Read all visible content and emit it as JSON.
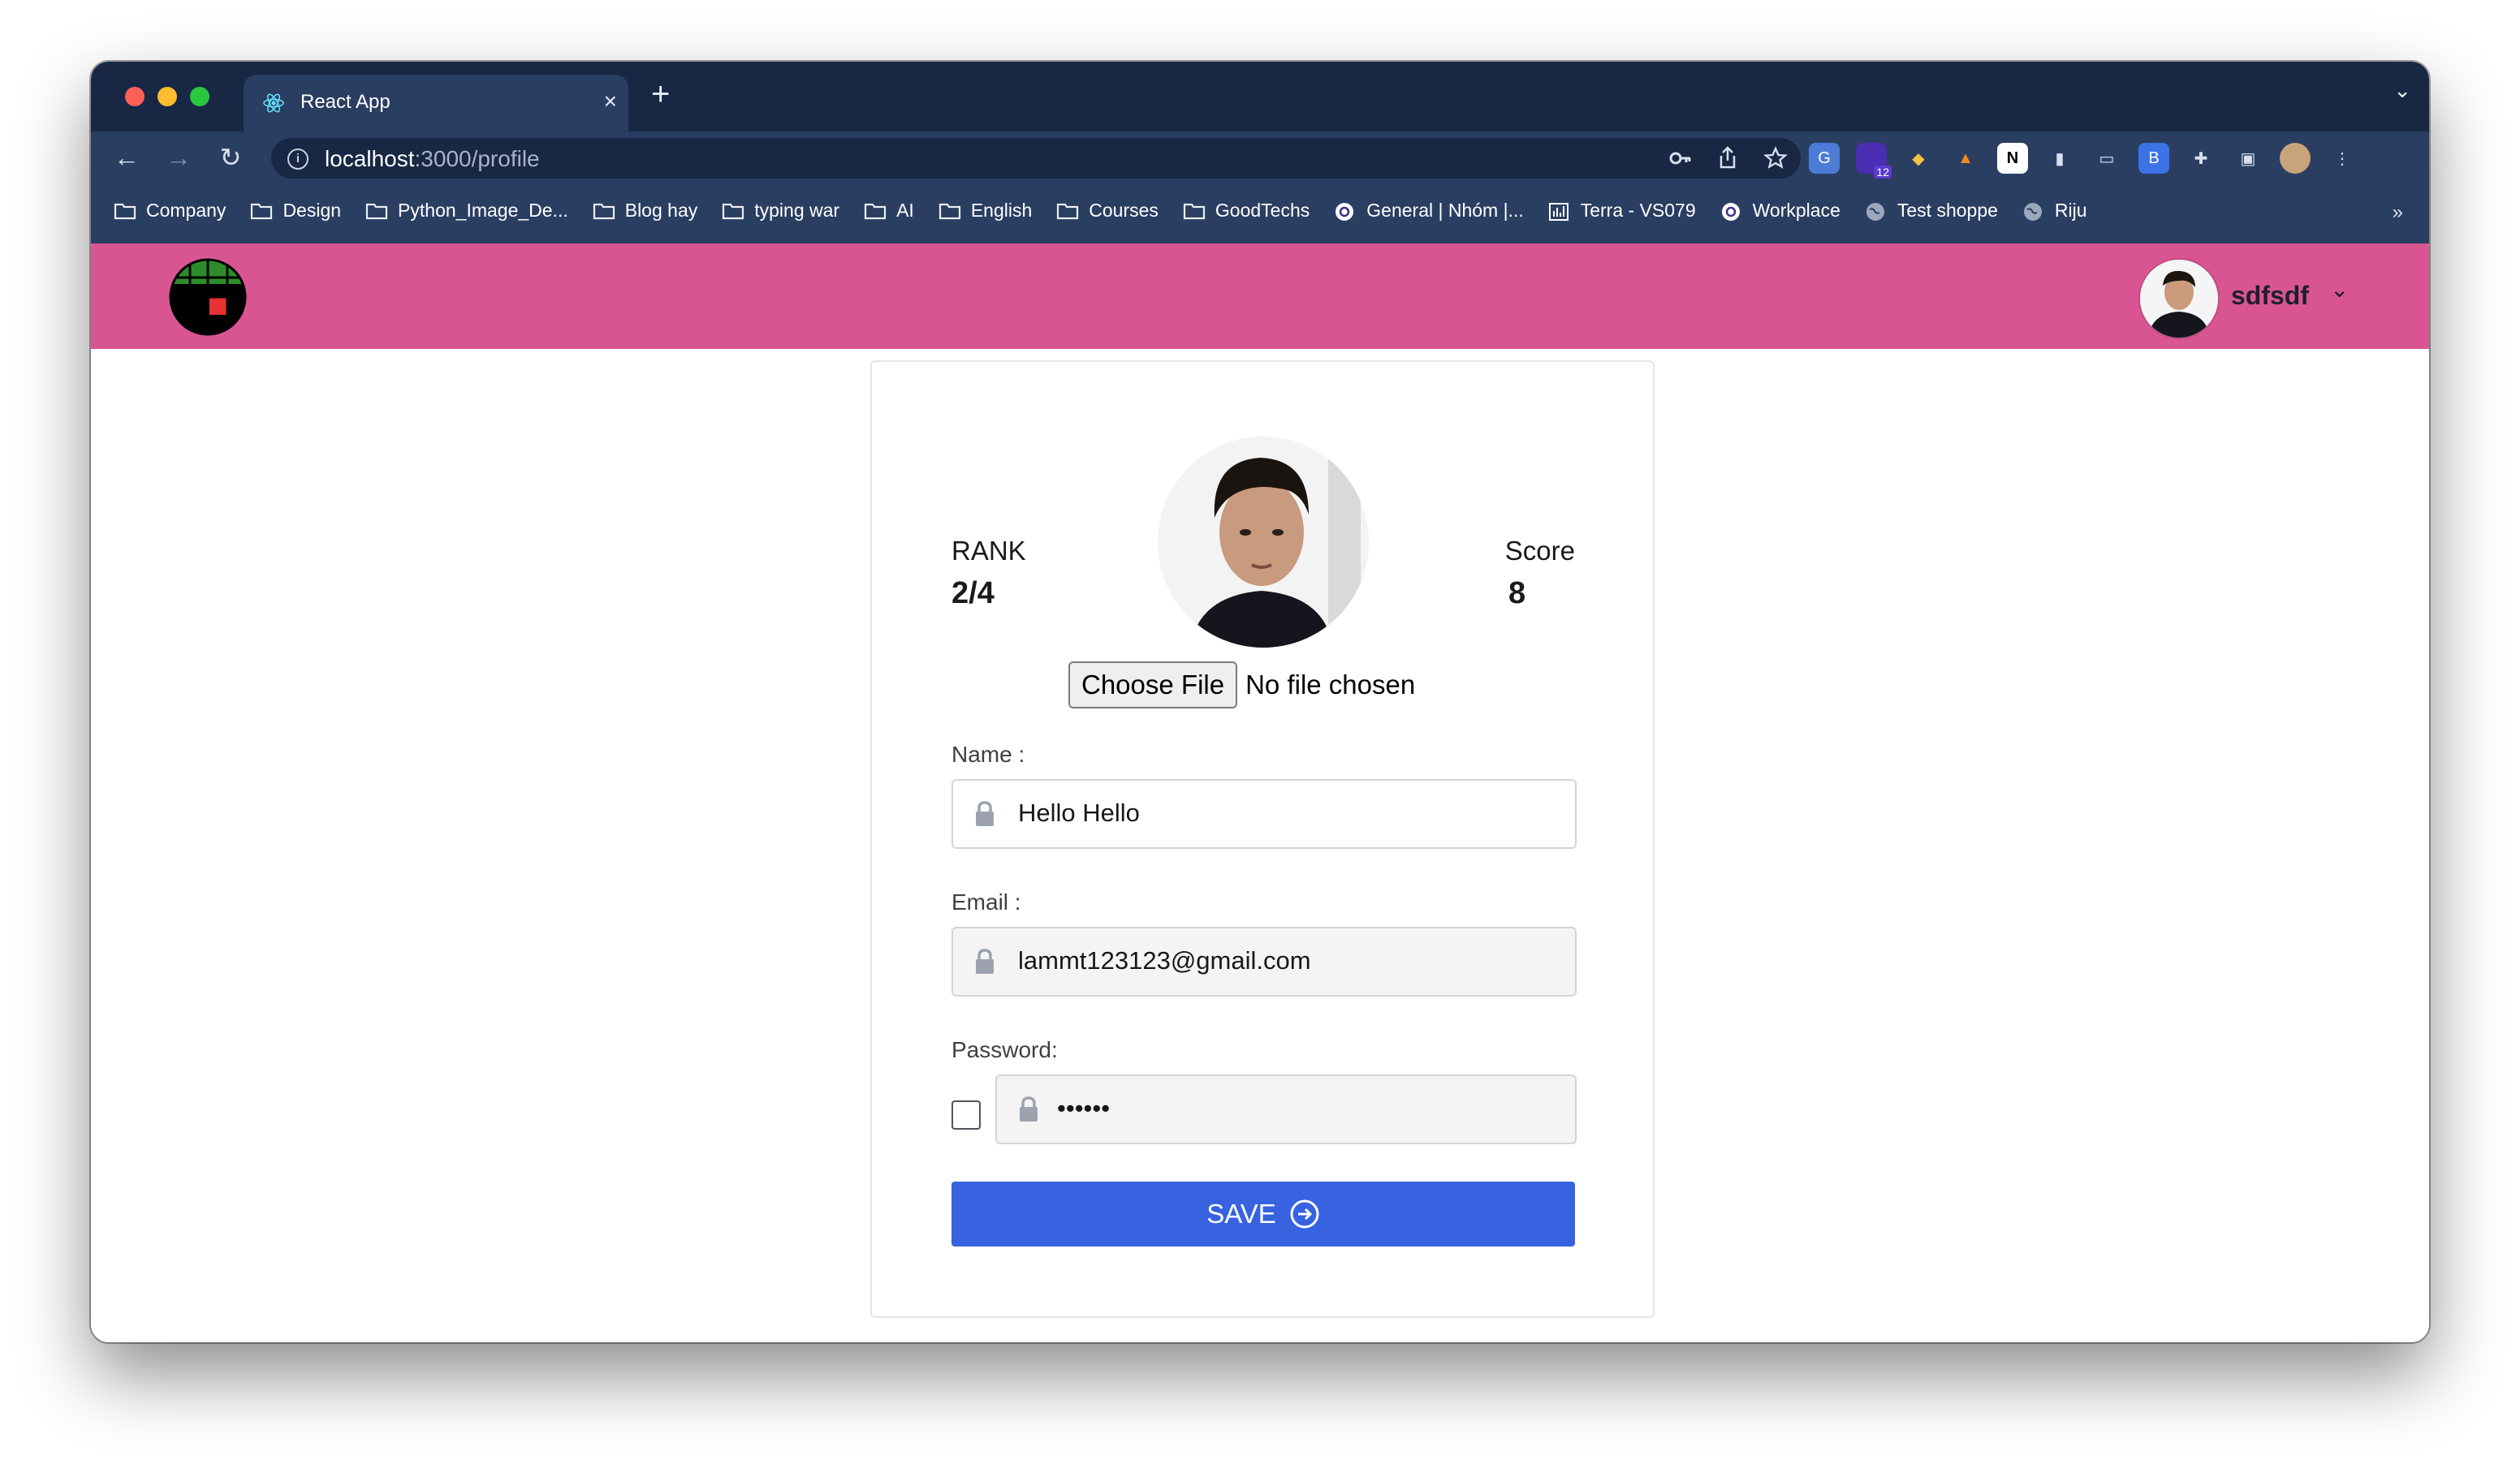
{
  "browser": {
    "tab_title": "React App",
    "tab_close": "×",
    "new_tab": "+",
    "tab_menu": "⌄",
    "url_host": "localhost",
    "url_path": ":3000/profile",
    "nav": {
      "back": "←",
      "forward": "→",
      "reload": "↻"
    },
    "omnibox_icons": [
      "key-icon",
      "share-icon",
      "star-icon"
    ],
    "extensions": [
      "google-translate-icon",
      "extension-badge-icon",
      "crypto-icon",
      "metamask-icon",
      "notion-icon",
      "bookmark-icon",
      "printer-icon",
      "b-extension-icon",
      "puzzle-icon",
      "sidepanel-icon",
      "profile-icon",
      "menu-icon"
    ],
    "extension_badge": "12",
    "bookmarks": [
      {
        "label": "Company",
        "icon": "folder-icon"
      },
      {
        "label": "Design",
        "icon": "folder-icon"
      },
      {
        "label": "Python_Image_De...",
        "icon": "folder-icon"
      },
      {
        "label": "Blog hay",
        "icon": "folder-icon"
      },
      {
        "label": "typing war",
        "icon": "folder-icon"
      },
      {
        "label": "AI",
        "icon": "folder-icon"
      },
      {
        "label": "English",
        "icon": "folder-icon"
      },
      {
        "label": "Courses",
        "icon": "folder-icon"
      },
      {
        "label": "GoodTechs",
        "icon": "folder-icon"
      },
      {
        "label": "General | Nhóm |...",
        "icon": "workplace-icon"
      },
      {
        "label": "Terra - VS079",
        "icon": "chart-icon"
      },
      {
        "label": "Workplace",
        "icon": "workplace-icon"
      },
      {
        "label": "Test shoppe",
        "icon": "globe-icon"
      },
      {
        "label": "Riju",
        "icon": "globe-icon"
      }
    ],
    "bookmarks_more": "»"
  },
  "app": {
    "header": {
      "user_name": "sdfsdf",
      "caret": "⌄"
    },
    "profile": {
      "rank_label": "RANK",
      "rank_value": "2/4",
      "score_label": "Score",
      "score_value": "8",
      "file_button": "Choose File",
      "file_status": "No file chosen",
      "name_label": "Name :",
      "name_value": "Hello Hello",
      "email_label": "Email :",
      "email_value": "lammt123123@gmail.com",
      "password_label": "Password:",
      "password_value": "••••••",
      "save_label": "SAVE"
    },
    "colors": {
      "header": "#d95592",
      "save_button": "#3762e0",
      "browser_dark": "#172744",
      "browser_toolbar": "#2a3e62"
    }
  }
}
